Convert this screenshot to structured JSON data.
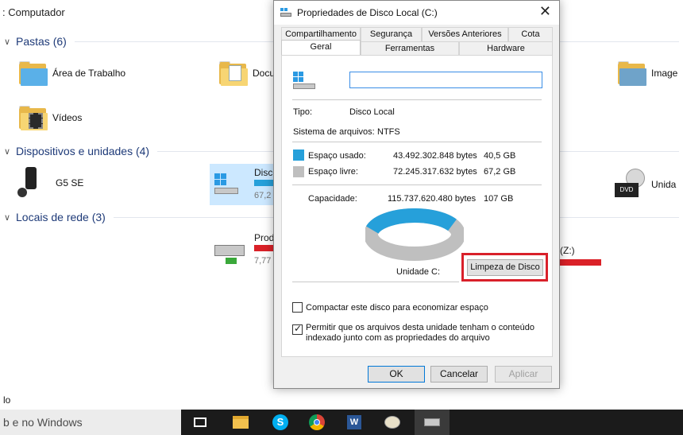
{
  "explorer": {
    "breadcrumb": ": Computador",
    "groups": {
      "pastas": "Pastas (6)",
      "dispositivos": "Dispositivos e unidades (4)",
      "rede": "Locais de rede (3)"
    },
    "folders": {
      "desktop": "Área de Trabalho",
      "documents": "Docu",
      "videos": "Vídeos",
      "images": "Image"
    },
    "devices": {
      "phone": "G5 SE",
      "disk_c_name": "Disco",
      "disk_c_free": "67,2",
      "dvd": "Unida"
    },
    "network": {
      "drive_name": "Prod",
      "drive_free": "7,77",
      "drive_z": "(Z:)"
    },
    "status": "lo"
  },
  "taskbar": {
    "search_text": "b e no Windows",
    "icons": [
      "task-view",
      "file-explorer",
      "skype",
      "chrome",
      "word",
      "paint",
      "disk-cleanup"
    ]
  },
  "dialog": {
    "title": "Propriedades de Disco Local (C:)",
    "close": "✕",
    "tabs_row1": [
      "Compartilhamento",
      "Segurança",
      "Versões Anteriores",
      "Cota"
    ],
    "tabs_row2": [
      "Geral",
      "Ferramentas",
      "Hardware"
    ],
    "selected_tab": "Geral",
    "name_value": "",
    "tipo_label": "Tipo:",
    "tipo_value": "Disco Local",
    "fs_label": "Sistema de arquivos:",
    "fs_value": "NTFS",
    "used": {
      "label": "Espaço usado:",
      "bytes": "43.492.302.848 bytes",
      "size": "40,5 GB",
      "color": "#26a0da"
    },
    "free": {
      "label": "Espaço livre:",
      "bytes": "72.245.317.632 bytes",
      "size": "67,2 GB",
      "color": "#bfbfbf"
    },
    "capacity": {
      "label": "Capacidade:",
      "bytes": "115.737.620.480 bytes",
      "size": "107 GB"
    },
    "used_fraction": 0.376,
    "drive_label": "Unidade C:",
    "cleanup_button": "Limpeza de Disco",
    "highlight_color": "#d9202a",
    "compress_label": "Compactar este disco para economizar espaço",
    "compress_checked": false,
    "index_label_1": "Permitir que os arquivos desta unidade tenham o conteúdo",
    "index_label_2": "indexado junto com as propriedades do arquivo",
    "index_checked": true,
    "ok": "OK",
    "cancel": "Cancelar",
    "apply": "Aplicar"
  }
}
